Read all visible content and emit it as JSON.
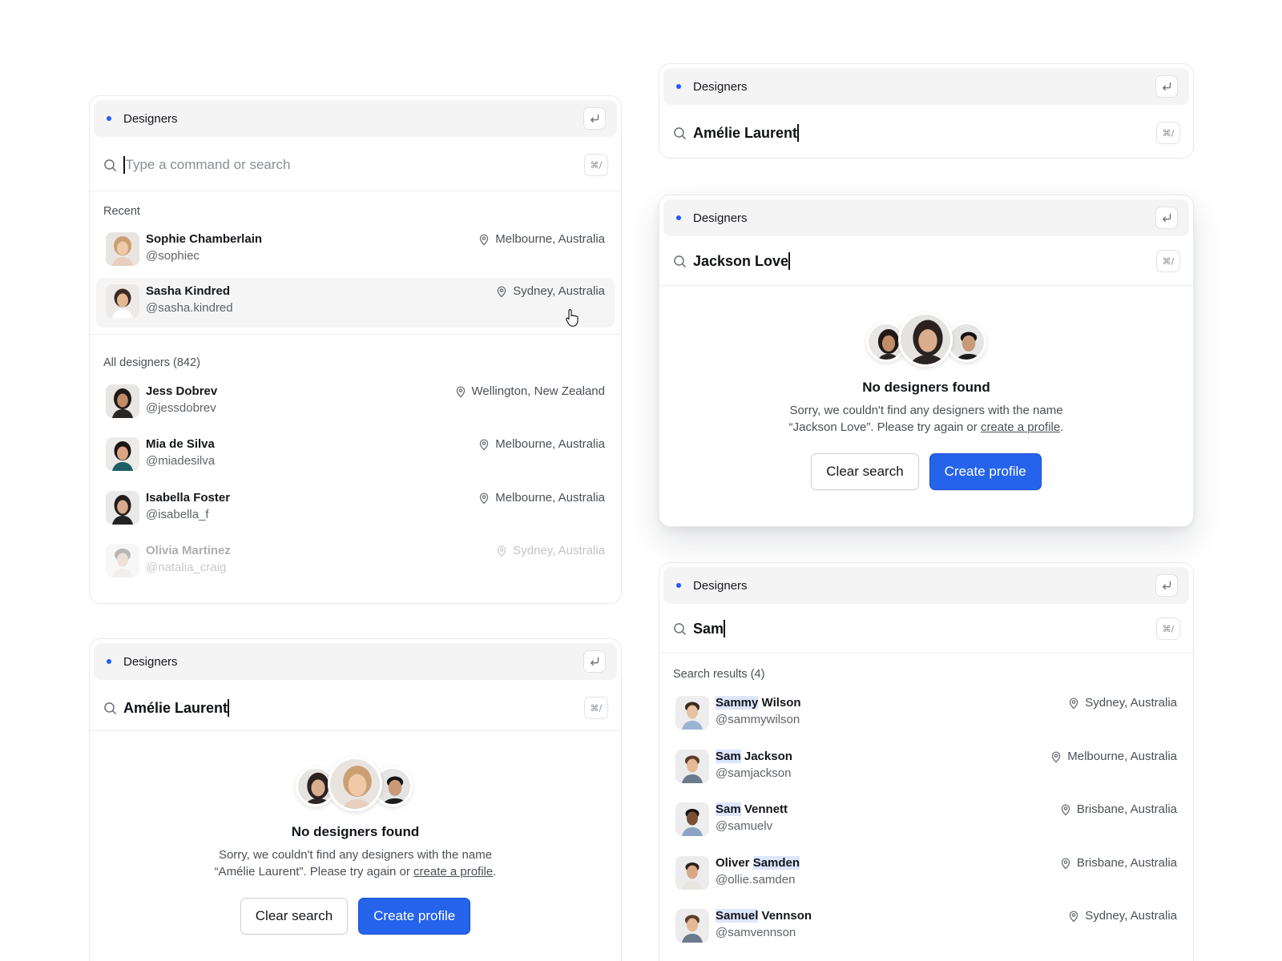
{
  "colors": {
    "accent": "#2563eb",
    "dot": "#1f5cff",
    "highlight": "#dde6ff"
  },
  "header_title": "Designers",
  "shortcut": "⌘/",
  "icons": {
    "search": "search-icon",
    "return": "return-icon",
    "location": "location-pin-icon"
  },
  "panel_main": {
    "placeholder": "Type a command or search",
    "recent_label": "Recent",
    "recent": [
      {
        "name": "Sophie Chamberlain",
        "handle": "@sophiec",
        "location": "Melbourne, Australia"
      },
      {
        "name": "Sasha Kindred",
        "handle": "@sasha.kindred",
        "location": "Sydney, Australia"
      }
    ],
    "all_label": "All designers (842)",
    "all": [
      {
        "name": "Jess Dobrev",
        "handle": "@jessdobrev",
        "location": "Wellington, New Zealand"
      },
      {
        "name": "Mia de Silva",
        "handle": "@miadesilva",
        "location": "Melbourne, Australia"
      },
      {
        "name": "Isabella Foster",
        "handle": "@isabella_f",
        "location": "Melbourne, Australia"
      },
      {
        "name": "Olivia Martinez",
        "handle": "@natalia_craig",
        "location": "Sydney, Australia"
      }
    ]
  },
  "panel_amelie_bottom": {
    "query": "Amélie Laurent",
    "empty_title": "No designers found",
    "empty_line1": "Sorry, we couldn't find any designers with the name",
    "empty_line2_prefix": "“Amélie Laurent”. Please try again or ",
    "empty_link": "create a profile",
    "empty_suffix": ".",
    "clear_label": "Clear search",
    "create_label": "Create profile"
  },
  "panel_amelie_top": {
    "query": "Amélie Laurent"
  },
  "panel_jackson": {
    "query": "Jackson Love",
    "empty_title": "No designers found",
    "empty_line1": "Sorry, we couldn't find any designers with the name",
    "empty_line2_prefix": "“Jackson Love”. Please try again or ",
    "empty_link": "create a profile",
    "empty_suffix": ".",
    "clear_label": "Clear search",
    "create_label": "Create profile"
  },
  "panel_sam": {
    "query": "Sam",
    "results_label": "Search results (4)",
    "results": [
      {
        "name_hl": "Sammy",
        "name_rest": " Wilson",
        "name_pre": "",
        "handle": "@sammywilson",
        "location": "Sydney, Australia"
      },
      {
        "name_hl": "Sam",
        "name_rest": " Jackson",
        "name_pre": "",
        "handle": "@samjackson",
        "location": "Melbourne, Australia"
      },
      {
        "name_hl": "Sam",
        "name_rest": " Vennett",
        "name_pre": "",
        "handle": "@samuelv",
        "location": "Brisbane, Australia"
      },
      {
        "name_hl": "Samden",
        "name_rest": "",
        "name_pre": "Oliver ",
        "handle": "@ollie.samden",
        "location": "Brisbane, Australia"
      },
      {
        "name_hl": "Samuel",
        "name_rest": " Vennson",
        "name_pre": "",
        "handle": "@samvennson",
        "location": "Sydney, Australia"
      }
    ]
  }
}
